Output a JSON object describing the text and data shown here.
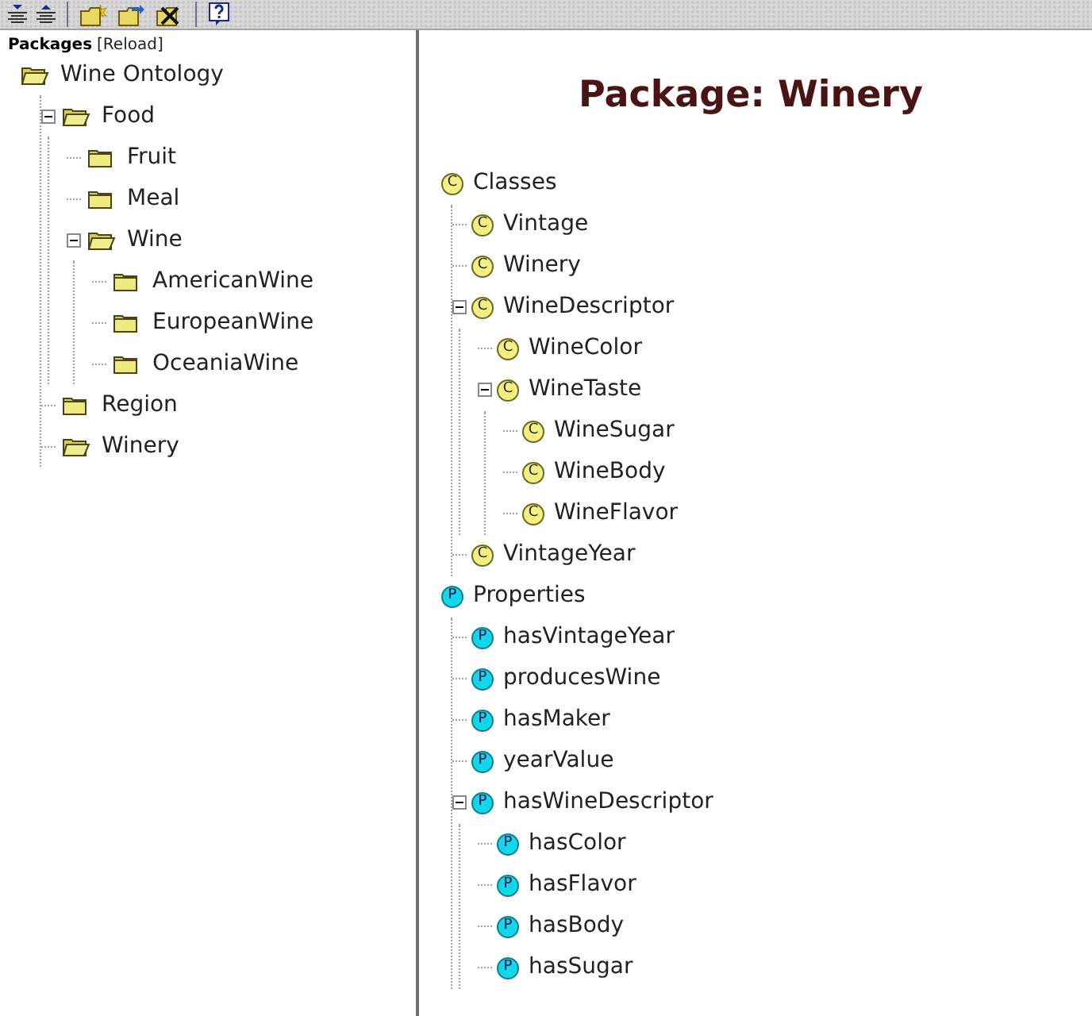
{
  "toolbar": {
    "buttons": [
      {
        "kind": "expand-all"
      },
      {
        "kind": "collapse-all"
      },
      {
        "kind": "sep"
      },
      {
        "kind": "new-folder"
      },
      {
        "kind": "move-folder"
      },
      {
        "kind": "delete-folder"
      },
      {
        "kind": "sep"
      },
      {
        "kind": "help"
      }
    ]
  },
  "packages": {
    "heading": "Packages",
    "reload_link": "[Reload]",
    "tree": [
      {
        "label": "Wine Ontology",
        "open": true,
        "children": [
          {
            "label": "Food",
            "open": true,
            "children": [
              {
                "label": "Fruit",
                "open": false
              },
              {
                "label": "Meal",
                "open": false
              },
              {
                "label": "Wine",
                "open": true,
                "children": [
                  {
                    "label": "AmericanWine",
                    "open": false
                  },
                  {
                    "label": "EuropeanWine",
                    "open": false
                  },
                  {
                    "label": "OceaniaWine",
                    "open": false
                  }
                ]
              }
            ]
          },
          {
            "label": "Region",
            "open": false
          },
          {
            "label": "Winery",
            "open": true
          }
        ]
      }
    ]
  },
  "detail": {
    "title": "Package: Winery",
    "sections": [
      {
        "kind": "class",
        "marker": "C",
        "label": "Classes",
        "children": [
          {
            "marker": "C",
            "label": "Vintage"
          },
          {
            "marker": "C",
            "label": "Winery"
          },
          {
            "marker": "C",
            "label": "WineDescriptor",
            "children": [
              {
                "marker": "C",
                "label": "WineColor"
              },
              {
                "marker": "C",
                "label": "WineTaste",
                "children": [
                  {
                    "marker": "C",
                    "label": "WineSugar"
                  },
                  {
                    "marker": "C",
                    "label": "WineBody"
                  },
                  {
                    "marker": "C",
                    "label": "WineFlavor"
                  }
                ]
              }
            ]
          },
          {
            "marker": "C",
            "label": "VintageYear"
          }
        ]
      },
      {
        "kind": "property",
        "marker": "P",
        "label": "Properties",
        "children": [
          {
            "marker": "P",
            "label": "hasVintageYear"
          },
          {
            "marker": "P",
            "label": "producesWine"
          },
          {
            "marker": "P",
            "label": "hasMaker"
          },
          {
            "marker": "P",
            "label": "yearValue"
          },
          {
            "marker": "P",
            "label": "hasWineDescriptor",
            "children": [
              {
                "marker": "P",
                "label": "hasColor"
              },
              {
                "marker": "P",
                "label": "hasFlavor"
              },
              {
                "marker": "P",
                "label": "hasBody"
              },
              {
                "marker": "P",
                "label": "hasSugar"
              }
            ]
          }
        ]
      }
    ]
  }
}
